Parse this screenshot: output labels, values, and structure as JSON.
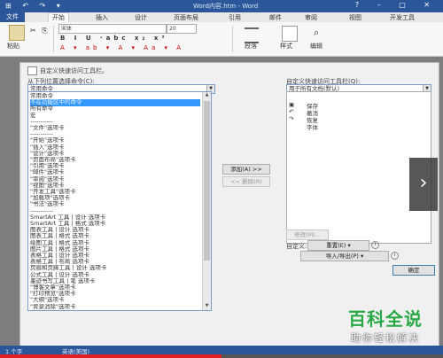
{
  "titlebar": {
    "title": "Word内容.htm - Word",
    "qat": "⊞ ↶ ↷ ▾"
  },
  "tabs": {
    "file": "文件",
    "items": [
      "开始",
      "插入",
      "设计",
      "页面布局",
      "引用",
      "邮件",
      "审阅",
      "视图",
      "开发工具"
    ]
  },
  "ribbon": {
    "paste_label": "粘贴",
    "font_name": "宋体",
    "font_size": "20",
    "paragraph_label": "段落",
    "styles_label": "样式",
    "editing_label": "编辑"
  },
  "dialog": {
    "header": "自定义快速访问工具栏。",
    "choose_label": "从下列位置选择命令(C):",
    "choose_value": "常用命令",
    "customize_label": "自定义快速访问工具栏(Q):",
    "customize_value": "用于所有文档(默认)",
    "list_items": [
      "常用命令",
      "不在功能区中的命令",
      "所有命令",
      "宏",
      "-----------",
      "\"文件\"选项卡",
      "-----------",
      "\"开始\"选项卡",
      "\"插入\"选项卡",
      "\"设计\"选项卡",
      "\"页面布局\"选项卡",
      "\"引用\"选项卡",
      "\"邮件\"选项卡",
      "\"审阅\"选项卡",
      "\"视图\"选项卡",
      "\"开发工具\"选项卡",
      "\"加载项\"选项卡",
      "\"书法\"选项卡",
      "-----------",
      "SmartArt 工具 | 设计 选项卡",
      "SmartArt 工具 | 格式 选项卡",
      "图表工具 | 设计 选项卡",
      "图表工具 | 格式 选项卡",
      "绘图工具 | 格式 选项卡",
      "图片工具 | 格式 选项卡",
      "表格工具 | 设计 选项卡",
      "表格工具 | 布局 选项卡",
      "页眉和页脚工具 | 设计 选项卡",
      "公式工具 | 设计 选项卡",
      "墨迹书写工具 | 笔 选项卡",
      "\"博客文章\"选项卡",
      "\"打印预览\"选项卡",
      "\"大纲\"选项卡",
      "\"背景消除\"选项卡"
    ],
    "selected_index": 1,
    "right_items": [
      "保存",
      "撤消",
      "恢复",
      "字体"
    ],
    "add_button": "添加(A) >>",
    "remove_button": "<< 删除(R)",
    "modify_button": "修改(M)...",
    "customize_key": "自定义:",
    "reset_button": "重置(E) ▾",
    "import_button": "导入/导出(P) ▾",
    "ok_button": "确定"
  },
  "status": {
    "left": "1 个字",
    "lang": "英语(美国)"
  },
  "overlay": {
    "next_arrow": "›",
    "watermark_main": "百科全说",
    "watermark_sub": "助你轻松解决",
    "progress": 0.5
  },
  "colors": {
    "accent": "#2b579a",
    "selection": "#3399ff",
    "watermark_green": "#27a844",
    "progress_red": "#e02020"
  }
}
